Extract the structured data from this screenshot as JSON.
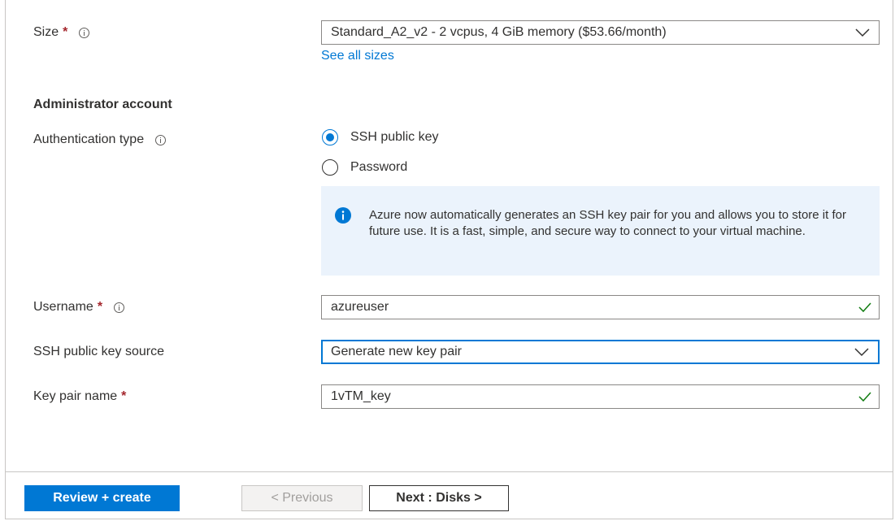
{
  "size": {
    "label": "Size",
    "required_mark": "*",
    "value": "Standard_A2_v2 - 2 vcpus, 4 GiB memory ($53.66/month)",
    "see_all_link": "See all sizes"
  },
  "admin_section": {
    "heading": "Administrator account"
  },
  "auth_type": {
    "label": "Authentication type",
    "options": [
      {
        "label": "SSH public key",
        "selected": true
      },
      {
        "label": "Password",
        "selected": false
      }
    ]
  },
  "info_box": {
    "text": "Azure now automatically generates an SSH key pair for you and allows you to store it for future use. It is a fast, simple, and secure way to connect to your virtual machine."
  },
  "username": {
    "label": "Username",
    "required_mark": "*",
    "value": "azureuser"
  },
  "ssh_key_source": {
    "label": "SSH public key source",
    "value": "Generate new key pair"
  },
  "key_pair_name": {
    "label": "Key pair name",
    "required_mark": "*",
    "value": "1vTM_key"
  },
  "footer": {
    "review_create": "Review + create",
    "previous": "< Previous",
    "next": "Next : Disks >"
  },
  "colors": {
    "accent": "#0078d4",
    "required": "#a4262c",
    "valid_check": "#107c10",
    "info_bg": "#ebf3fc"
  }
}
